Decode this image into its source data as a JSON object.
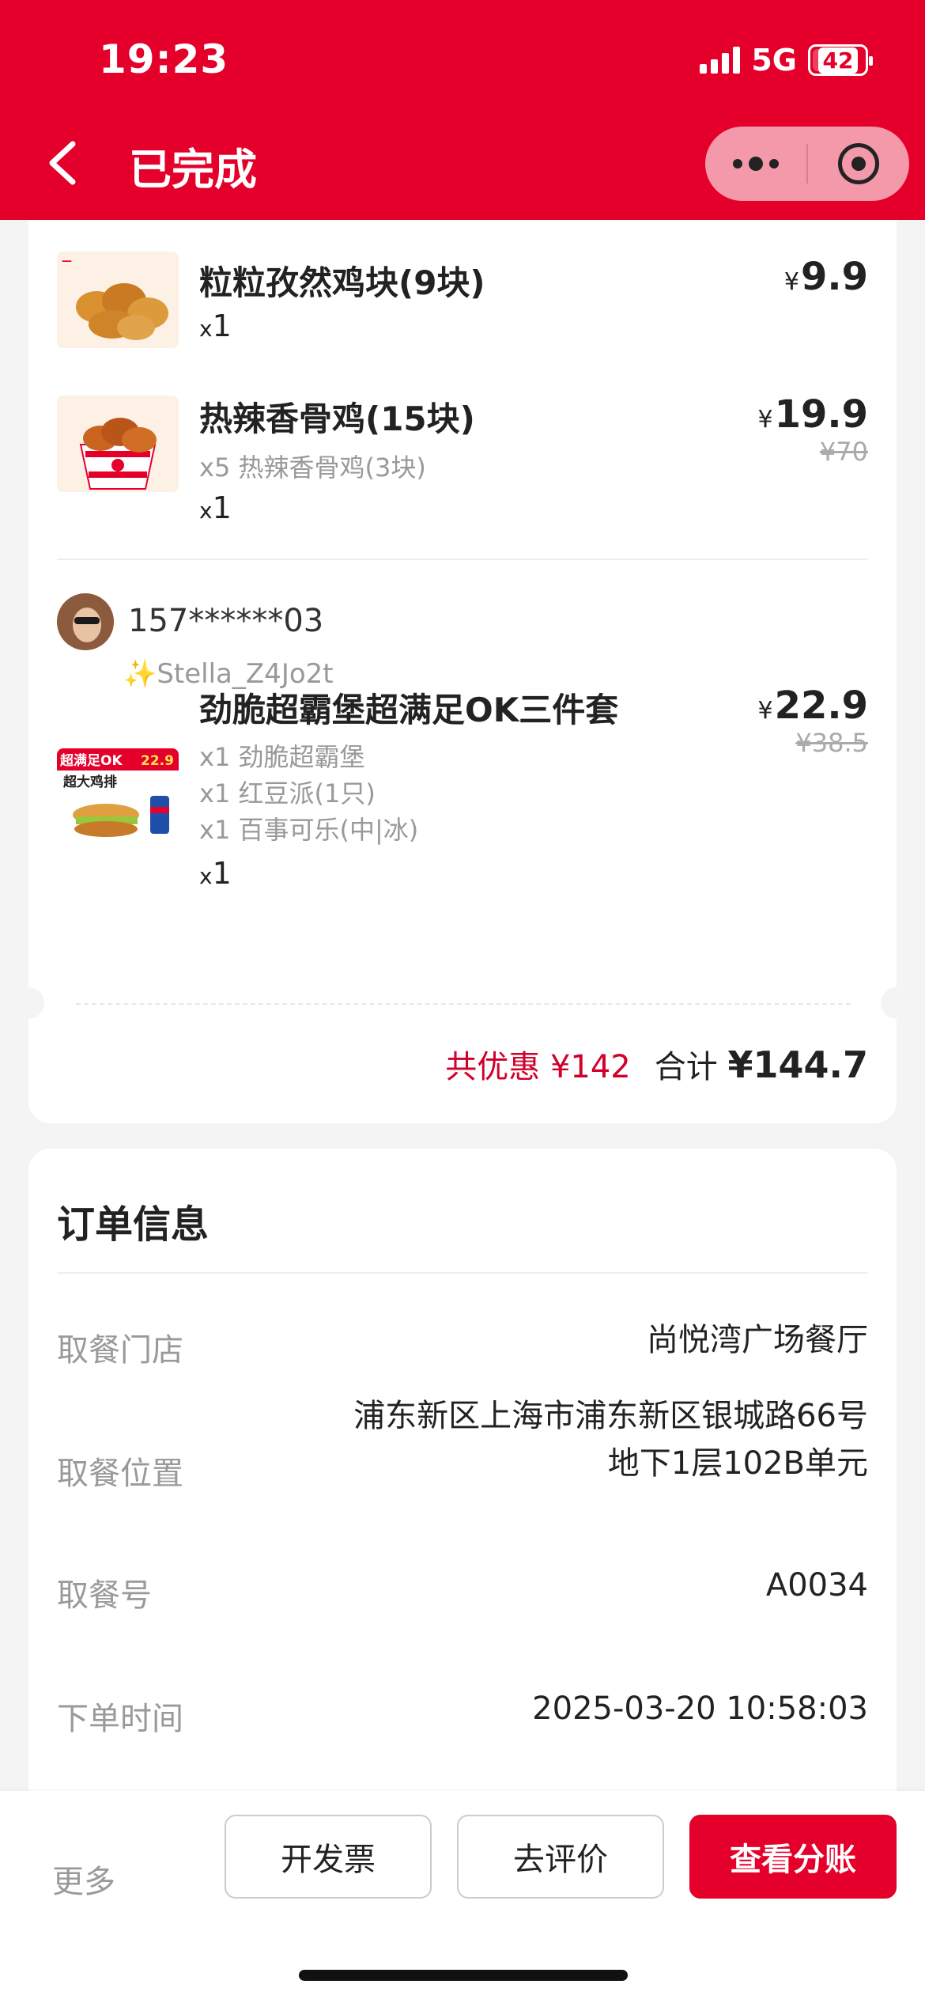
{
  "status_bar": {
    "time": "19:23",
    "network": "5G",
    "battery": "42"
  },
  "header": {
    "title": "已完成"
  },
  "items": [
    {
      "name": "粒粒孜然鸡块(9块)",
      "price": "9.9",
      "currency": "¥",
      "qty_prefix": "x",
      "qty": "1"
    },
    {
      "name": "热辣香骨鸡(15块)",
      "sub": "x5 热辣香骨鸡(3块)",
      "price": "19.9",
      "original_price": "¥70",
      "currency": "¥",
      "qty_prefix": "x",
      "qty": "1"
    },
    {
      "name": "劲脆超霸堡超满足OK三件套",
      "subs": [
        "x1 劲脆超霸堡",
        "x1 红豆派(1只)",
        "x1 百事可乐(中|冰)"
      ],
      "price": "22.9",
      "original_price": "¥38.5",
      "currency": "¥",
      "qty_prefix": "x",
      "qty": "1",
      "thumb_text": {
        "badge": "超满足OK",
        "badge_price": "22.9",
        "headline": "超大鸡排"
      }
    }
  ],
  "user": {
    "phone": "157******03",
    "nickname": "✨Stella_Z4Jo2t"
  },
  "summary": {
    "savings": "共优惠 ¥142",
    "total_label": "合计",
    "total": "¥144.7"
  },
  "order_info": {
    "title": "订单信息",
    "rows": [
      {
        "label": "取餐门店",
        "value": "尚悦湾广场餐厅"
      },
      {
        "label": "取餐位置",
        "value_line1": "浦东新区上海市浦东新区银城路66号",
        "value_line2": "地下1层102B单元"
      },
      {
        "label": "取餐号",
        "value": "A0034"
      },
      {
        "label": "下单时间",
        "value": "2025-03-20 10:58:03"
      }
    ]
  },
  "bottom_bar": {
    "more": "更多",
    "invoice": "开发票",
    "review": "去评价",
    "split": "查看分账"
  },
  "colors": {
    "brand_red": "#e4002b",
    "savings_red": "#d1002a",
    "muted": "#999999"
  },
  "icons": [
    "back-chevron-icon",
    "more-dots-icon",
    "close-target-icon",
    "signal-icon",
    "battery-icon"
  ]
}
